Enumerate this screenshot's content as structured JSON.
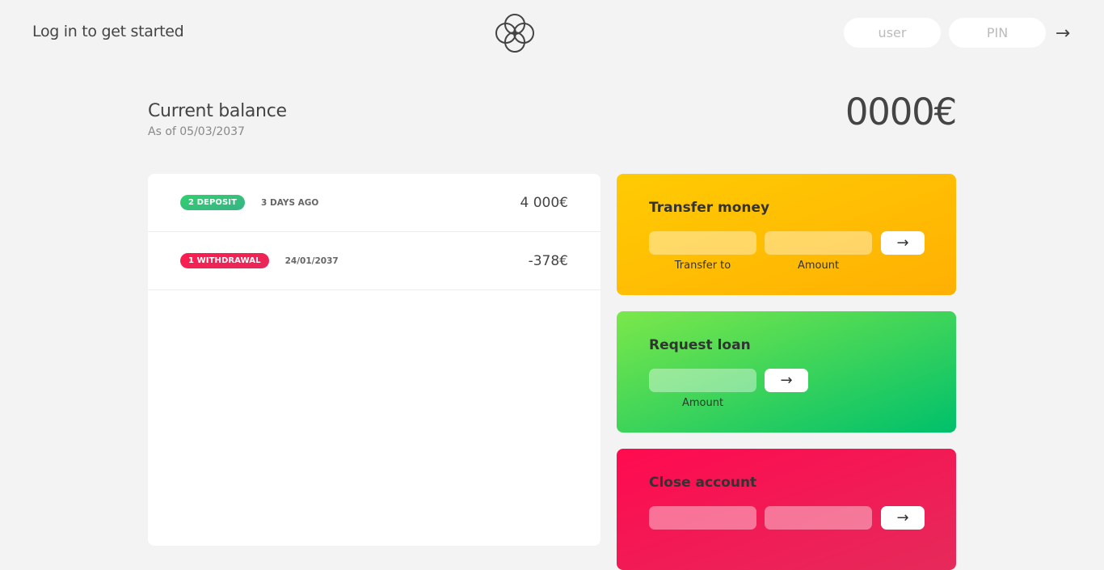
{
  "nav": {
    "welcome": "Log in to get started",
    "user_placeholder": "user",
    "pin_placeholder": "PIN",
    "login_arrow": "→",
    "logo_icon": "four-circles-logo-icon"
  },
  "balance": {
    "label": "Current balance",
    "date": "As of 05/03/2037",
    "value": "0000€"
  },
  "movements": [
    {
      "type_label": "2 deposit",
      "kind": "deposit",
      "date": "3 days ago",
      "value": "4 000€"
    },
    {
      "type_label": "1 withdrawal",
      "kind": "withdrawal",
      "date": "24/01/2037",
      "value": "-378€"
    }
  ],
  "operations": {
    "transfer": {
      "title": "Transfer money",
      "label1": "Transfer to",
      "label2": "Amount",
      "button": "→"
    },
    "loan": {
      "title": "Request loan",
      "label1": "Amount",
      "button": "→"
    },
    "close": {
      "title": "Close account",
      "button": "→"
    }
  },
  "colors": {
    "background": "#f3f3f3",
    "deposit": "#39b385",
    "withdrawal": "#e52a5a",
    "transfer": "#ffb003",
    "loan": "#00c06b",
    "close": "#ff0a50"
  }
}
